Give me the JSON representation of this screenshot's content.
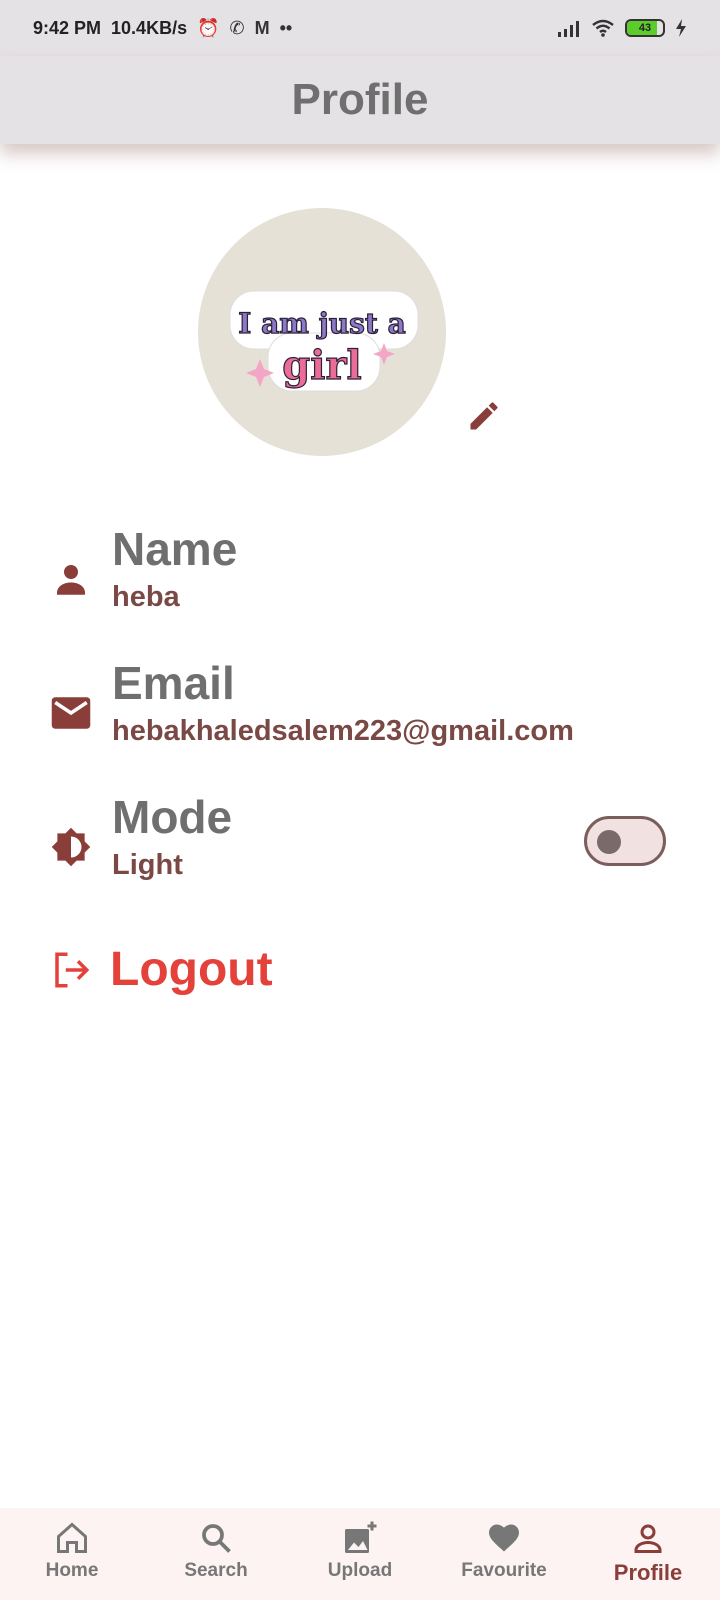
{
  "status_bar": {
    "time": "9:42 PM",
    "speed": "10.4KB/s",
    "icons": [
      "alarm-icon",
      "whatsapp-icon",
      "gmail-icon",
      "more-dots-icon",
      "signal-icon",
      "wifi-icon",
      "charging-icon"
    ],
    "battery": "43"
  },
  "app_bar": {
    "title": "Profile"
  },
  "avatar": {
    "sticker_line1": "I am just a",
    "sticker_line2": "girl"
  },
  "name_row": {
    "title": "Name",
    "value": "heba",
    "icon": "person-icon"
  },
  "email_row": {
    "title": "Email",
    "value": "hebakhaledsalem223@gmail.com",
    "icon": "mail-icon"
  },
  "mode_row": {
    "title": "Mode",
    "value": "Light",
    "icon": "brightness-icon",
    "toggle_on": false
  },
  "logout": {
    "label": "Logout",
    "icon": "logout-icon"
  },
  "bottom_nav": {
    "items": [
      {
        "label": "Home",
        "icon": "home-icon"
      },
      {
        "label": "Search",
        "icon": "search-icon"
      },
      {
        "label": "Upload",
        "icon": "add-photo-icon"
      },
      {
        "label": "Favourite",
        "icon": "heart-icon"
      },
      {
        "label": "Profile",
        "icon": "person-outline-icon"
      }
    ],
    "active": "Profile"
  },
  "colors": {
    "accent": "#8a3e3a",
    "title_gray": "#6f6f6f",
    "logout_red": "#e5413b",
    "bar_bg": "#e5e2e6",
    "nav_bg": "#fdf3f3"
  }
}
